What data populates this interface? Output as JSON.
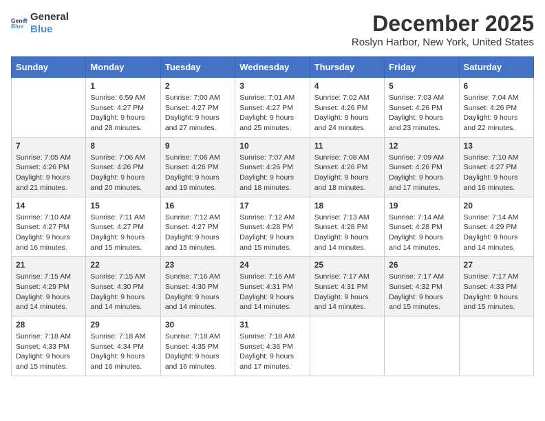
{
  "logo": {
    "line1": "General",
    "line2": "Blue"
  },
  "title": "December 2025",
  "subtitle": "Roslyn Harbor, New York, United States",
  "days_of_week": [
    "Sunday",
    "Monday",
    "Tuesday",
    "Wednesday",
    "Thursday",
    "Friday",
    "Saturday"
  ],
  "weeks": [
    [
      {
        "day": "",
        "info": ""
      },
      {
        "day": "1",
        "info": "Sunrise: 6:59 AM\nSunset: 4:27 PM\nDaylight: 9 hours\nand 28 minutes."
      },
      {
        "day": "2",
        "info": "Sunrise: 7:00 AM\nSunset: 4:27 PM\nDaylight: 9 hours\nand 27 minutes."
      },
      {
        "day": "3",
        "info": "Sunrise: 7:01 AM\nSunset: 4:27 PM\nDaylight: 9 hours\nand 25 minutes."
      },
      {
        "day": "4",
        "info": "Sunrise: 7:02 AM\nSunset: 4:26 PM\nDaylight: 9 hours\nand 24 minutes."
      },
      {
        "day": "5",
        "info": "Sunrise: 7:03 AM\nSunset: 4:26 PM\nDaylight: 9 hours\nand 23 minutes."
      },
      {
        "day": "6",
        "info": "Sunrise: 7:04 AM\nSunset: 4:26 PM\nDaylight: 9 hours\nand 22 minutes."
      }
    ],
    [
      {
        "day": "7",
        "info": "Sunrise: 7:05 AM\nSunset: 4:26 PM\nDaylight: 9 hours\nand 21 minutes."
      },
      {
        "day": "8",
        "info": "Sunrise: 7:06 AM\nSunset: 4:26 PM\nDaylight: 9 hours\nand 20 minutes."
      },
      {
        "day": "9",
        "info": "Sunrise: 7:06 AM\nSunset: 4:26 PM\nDaylight: 9 hours\nand 19 minutes."
      },
      {
        "day": "10",
        "info": "Sunrise: 7:07 AM\nSunset: 4:26 PM\nDaylight: 9 hours\nand 18 minutes."
      },
      {
        "day": "11",
        "info": "Sunrise: 7:08 AM\nSunset: 4:26 PM\nDaylight: 9 hours\nand 18 minutes."
      },
      {
        "day": "12",
        "info": "Sunrise: 7:09 AM\nSunset: 4:26 PM\nDaylight: 9 hours\nand 17 minutes."
      },
      {
        "day": "13",
        "info": "Sunrise: 7:10 AM\nSunset: 4:27 PM\nDaylight: 9 hours\nand 16 minutes."
      }
    ],
    [
      {
        "day": "14",
        "info": "Sunrise: 7:10 AM\nSunset: 4:27 PM\nDaylight: 9 hours\nand 16 minutes."
      },
      {
        "day": "15",
        "info": "Sunrise: 7:11 AM\nSunset: 4:27 PM\nDaylight: 9 hours\nand 15 minutes."
      },
      {
        "day": "16",
        "info": "Sunrise: 7:12 AM\nSunset: 4:27 PM\nDaylight: 9 hours\nand 15 minutes."
      },
      {
        "day": "17",
        "info": "Sunrise: 7:12 AM\nSunset: 4:28 PM\nDaylight: 9 hours\nand 15 minutes."
      },
      {
        "day": "18",
        "info": "Sunrise: 7:13 AM\nSunset: 4:28 PM\nDaylight: 9 hours\nand 14 minutes."
      },
      {
        "day": "19",
        "info": "Sunrise: 7:14 AM\nSunset: 4:28 PM\nDaylight: 9 hours\nand 14 minutes."
      },
      {
        "day": "20",
        "info": "Sunrise: 7:14 AM\nSunset: 4:29 PM\nDaylight: 9 hours\nand 14 minutes."
      }
    ],
    [
      {
        "day": "21",
        "info": "Sunrise: 7:15 AM\nSunset: 4:29 PM\nDaylight: 9 hours\nand 14 minutes."
      },
      {
        "day": "22",
        "info": "Sunrise: 7:15 AM\nSunset: 4:30 PM\nDaylight: 9 hours\nand 14 minutes."
      },
      {
        "day": "23",
        "info": "Sunrise: 7:16 AM\nSunset: 4:30 PM\nDaylight: 9 hours\nand 14 minutes."
      },
      {
        "day": "24",
        "info": "Sunrise: 7:16 AM\nSunset: 4:31 PM\nDaylight: 9 hours\nand 14 minutes."
      },
      {
        "day": "25",
        "info": "Sunrise: 7:17 AM\nSunset: 4:31 PM\nDaylight: 9 hours\nand 14 minutes."
      },
      {
        "day": "26",
        "info": "Sunrise: 7:17 AM\nSunset: 4:32 PM\nDaylight: 9 hours\nand 15 minutes."
      },
      {
        "day": "27",
        "info": "Sunrise: 7:17 AM\nSunset: 4:33 PM\nDaylight: 9 hours\nand 15 minutes."
      }
    ],
    [
      {
        "day": "28",
        "info": "Sunrise: 7:18 AM\nSunset: 4:33 PM\nDaylight: 9 hours\nand 15 minutes."
      },
      {
        "day": "29",
        "info": "Sunrise: 7:18 AM\nSunset: 4:34 PM\nDaylight: 9 hours\nand 16 minutes."
      },
      {
        "day": "30",
        "info": "Sunrise: 7:18 AM\nSunset: 4:35 PM\nDaylight: 9 hours\nand 16 minutes."
      },
      {
        "day": "31",
        "info": "Sunrise: 7:18 AM\nSunset: 4:36 PM\nDaylight: 9 hours\nand 17 minutes."
      },
      {
        "day": "",
        "info": ""
      },
      {
        "day": "",
        "info": ""
      },
      {
        "day": "",
        "info": ""
      }
    ]
  ]
}
